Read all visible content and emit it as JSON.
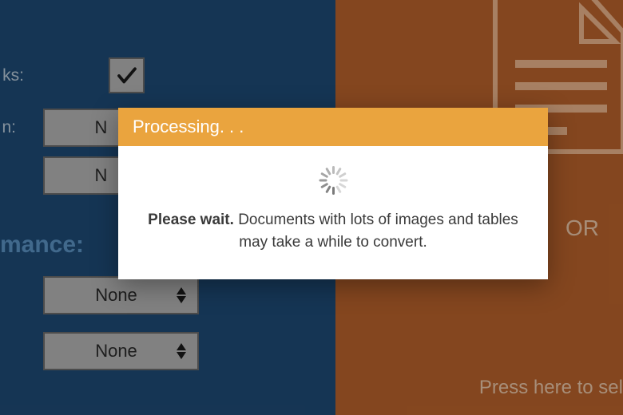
{
  "left": {
    "rows": {
      "links": {
        "label": "ks:",
        "checked": true
      },
      "option_n1": {
        "label": "n:",
        "value": "N"
      },
      "option_n2": {
        "value": "N"
      }
    },
    "section_heading": "mance:",
    "steppers": [
      {
        "value": "None"
      },
      {
        "value": "None"
      }
    ]
  },
  "right": {
    "or_label": "OR",
    "press_label": "Press here to sel"
  },
  "modal": {
    "title": "Processing. . .",
    "wait_label": "Please wait.",
    "message_tail": "Documents with lots of images and tables may take a while to convert."
  },
  "colors": {
    "left_bg": "#1e4a75",
    "right_bg": "#b8622b",
    "modal_header": "#eaa43e"
  }
}
